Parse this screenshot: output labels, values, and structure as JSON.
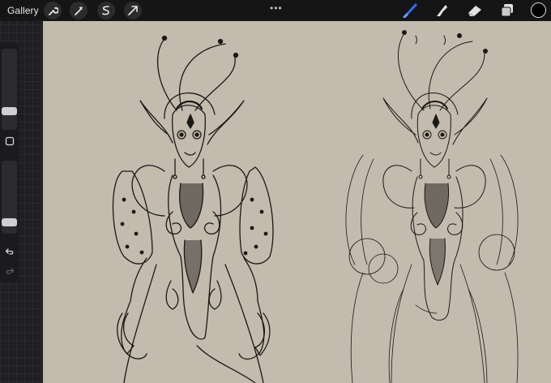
{
  "toolbar": {
    "gallery_label": "Gallery",
    "left_tools": [
      "wrench-icon",
      "magic-wand-icon",
      "selection-icon",
      "transform-arrow-icon"
    ],
    "more_label": "•••",
    "right_tools": [
      "brush-icon",
      "smudge-icon",
      "eraser-icon",
      "layers-icon"
    ],
    "current_color": "#000000",
    "accent_color": "#2f6df6"
  },
  "sidebar": {
    "brush_size_level": 0.2,
    "opacity_level": 0.8,
    "buttons": [
      "modify-square-icon",
      "undo-icon",
      "redo-icon"
    ]
  },
  "canvas": {
    "paper_color": "#c4bbaf",
    "ink_color": "#1a1816"
  }
}
